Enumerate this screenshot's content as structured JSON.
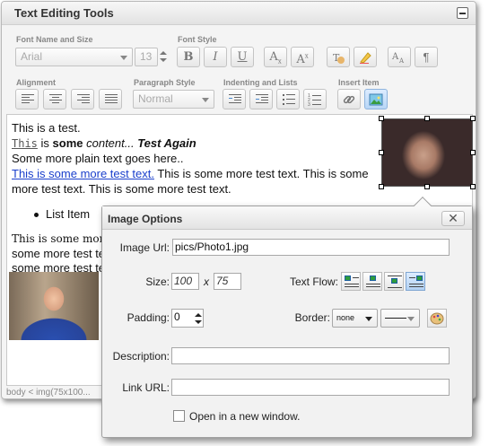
{
  "editor": {
    "title": "Text Editing Tools",
    "labels": {
      "font_name_size": "Font Name and Size",
      "font_style": "Font Style",
      "alignment": "Alignment",
      "paragraph_style": "Paragraph Style",
      "indenting_lists": "Indenting and Lists",
      "insert_item": "Insert Item"
    },
    "font_name": "Arial",
    "font_size": "13",
    "paragraph_style": "Normal",
    "style_buttons": {
      "bold": "B",
      "italic": "I",
      "underline": "U"
    },
    "status_path": "body < img(75x100..."
  },
  "content": {
    "line1": "This is a test.",
    "line2_code": "This",
    "line2_is": " is ",
    "line2_bold": "some",
    "line2_italic": " content... ",
    "line2_bold_italic": "Test Again",
    "line3": "Some more plain text goes here..",
    "line4_link": "This is some more test text.",
    "line4_rest": " This is some more test text. This is some",
    "line5": "more test text. This is some more test text.",
    "list_item": "List Item",
    "serif_line1": "This is some more te",
    "serif_line2": "some more test te",
    "serif_line3": "some more test te"
  },
  "dialog": {
    "title": "Image Options",
    "close": "✕",
    "image_url_label": "Image Url:",
    "image_url": "pics/Photo1.jpg",
    "size_label": "Size:",
    "width": "100",
    "x_sep": "x",
    "height": "75",
    "text_flow_label": "Text Flow:",
    "padding_label": "Padding:",
    "padding": "0",
    "border_label": "Border:",
    "border_style": "none",
    "description_label": "Description:",
    "description": "",
    "link_url_label": "Link URL:",
    "link_url": "",
    "new_window_label": "Open in a new window."
  }
}
